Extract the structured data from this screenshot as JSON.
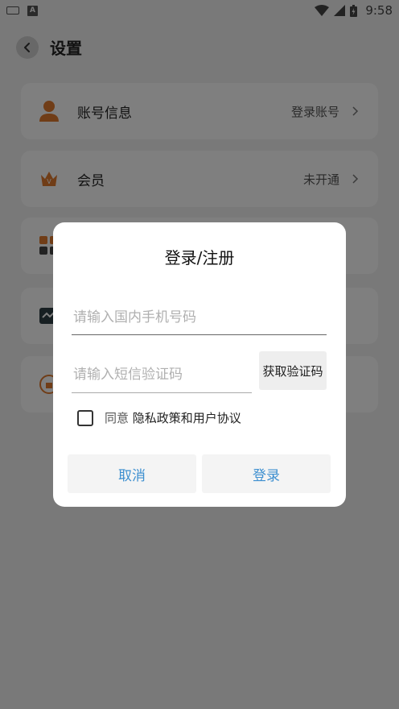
{
  "status_bar": {
    "time": "9:58",
    "a_badge": "A"
  },
  "header": {
    "title": "设置"
  },
  "settings": [
    {
      "label": "账号信息",
      "value": "登录账号",
      "icon": "person-icon"
    },
    {
      "label": "会员",
      "value": "未开通",
      "icon": "crown-icon"
    },
    {
      "label": "",
      "value": "",
      "icon": "apps-icon"
    },
    {
      "label": "",
      "value": "",
      "icon": "chart-icon"
    },
    {
      "label": "",
      "value": "",
      "icon": "lock-icon"
    }
  ],
  "dialog": {
    "title": "登录/注册",
    "phone_placeholder": "请输入国内手机号码",
    "code_placeholder": "请输入短信验证码",
    "get_code_label": "获取验证码",
    "agree_prefix": "同意",
    "agree_link": "隐私政策和用户协议",
    "cancel_label": "取消",
    "login_label": "登录"
  },
  "colors": {
    "accent": "#3d8fd0",
    "icon_orange": "#e07a2e"
  }
}
